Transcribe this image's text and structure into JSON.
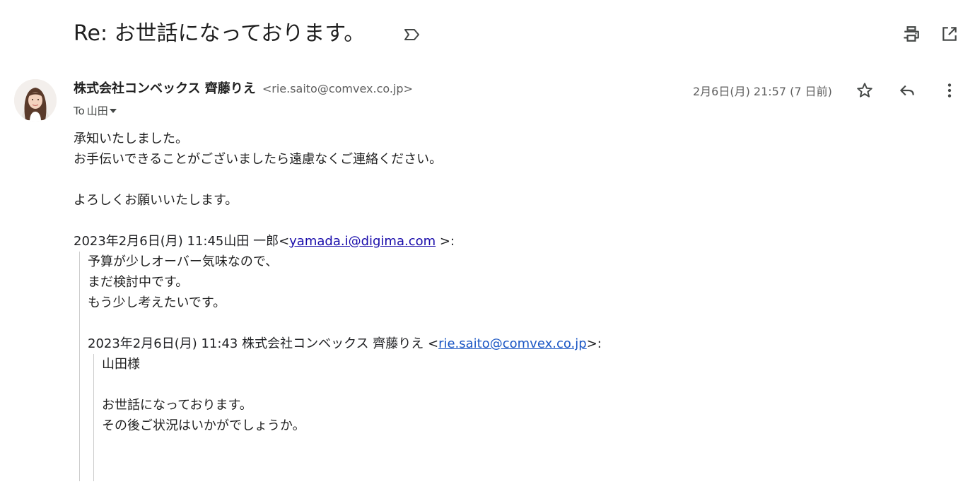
{
  "subject": "Re: お世話になっております。",
  "message": {
    "sender_name": "株式会社コンベックス 齊藤りえ",
    "sender_email": "<rie.saito@comvex.co.jp>",
    "to_label": "To",
    "to_name": "山田",
    "date": "2月6日(月) 21:57 (7 日前)"
  },
  "body": {
    "lines": [
      "承知いたしました。",
      "お手伝いできることがございましたら遠慮なくご連絡ください。",
      "よろしくお願いいたします。"
    ]
  },
  "quote1": {
    "header_prefix": "2023年2月6日(月) 11:45山田 一郎<",
    "header_link": "yamada.i@digima.com",
    "header_suffix": " >:",
    "lines": [
      "予算が少しオーバー気味なので、",
      "まだ検討中です。",
      "もう少し考えたいです。"
    ]
  },
  "quote2": {
    "header_prefix": "2023年2月6日(月) 11:43 株式会社コンベックス 齊藤りえ <",
    "header_link": "rie.saito@comvex.co.jp",
    "header_suffix": ">:",
    "lines": [
      "山田様",
      "お世話になっております。",
      "その後ご状況はいかがでしょうか。"
    ]
  },
  "icons": {
    "label": "label-important-icon",
    "print": "print-icon",
    "open_new": "open-in-new-window-icon",
    "star": "star-icon",
    "reply": "reply-icon",
    "more": "more-vert-icon",
    "avatar": "sender-avatar"
  },
  "colors": {
    "link": "#1a0dab",
    "icon": "#444746",
    "quote_border": "#cccccc"
  }
}
